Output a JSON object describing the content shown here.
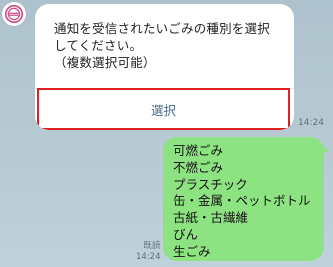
{
  "avatar": {
    "icon": "emblem-icon",
    "color": "#d04a86"
  },
  "incoming": {
    "prompt_text": "通知を受信されたいごみの種別を選択\nしてください。\n（複数選択可能）",
    "select_label": "選択",
    "time": "14:24"
  },
  "outgoing": {
    "reply_text": "可燃ごみ\n不燃ごみ\nプラスチック\n缶・金属・ペットボトル\n古紙・古繊維\nびん\n生ごみ",
    "read_label": "既読",
    "time": "14:24"
  },
  "colors": {
    "chat_background": "#b8ccd6",
    "outgoing_bubble": "#8de281",
    "incoming_bubble": "#ffffff",
    "highlight_border": "#e02020",
    "button_text": "#4a6b8a"
  }
}
